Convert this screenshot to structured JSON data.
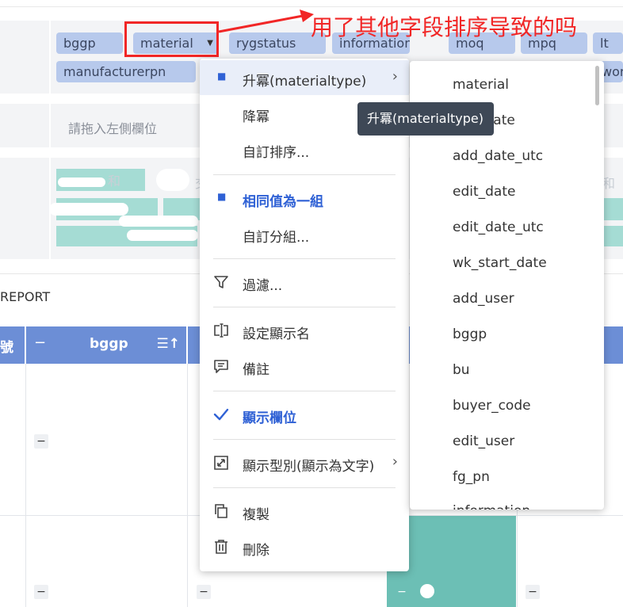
{
  "pivot": {
    "row_fields": [
      "bggp",
      "material",
      "rygstatus",
      "information",
      "moq",
      "mpq",
      "lt",
      "manufacturerpn",
      "wor"
    ],
    "drop_hint": "請拖入左側欄位",
    "faint_texts": [
      "和",
      "和",
      "交"
    ]
  },
  "report": {
    "title": "REPORT"
  },
  "grid": {
    "header_col": "bggp",
    "header_prefix": "號",
    "collapse_symbol": "−"
  },
  "annotation": {
    "text": "用了其他字段排序导致的吗"
  },
  "context_menu": {
    "sort_asc": "升冪(materialtype)",
    "sort_desc": "降冪",
    "custom_sort": "自訂排序...",
    "group_same": "相同值為一組",
    "custom_group": "自訂分組...",
    "filter": "過濾...",
    "set_display_name": "設定顯示名",
    "note": "備註",
    "show_field": "顯示欄位",
    "display_type": "顯示型別(顯示為文字)",
    "copy": "複製",
    "delete": "刪除"
  },
  "submenu": {
    "items": [
      "material",
      "add_date",
      "add_date_utc",
      "edit_date",
      "edit_date_utc",
      "wk_start_date",
      "add_user",
      "bggp",
      "bu",
      "buyer_code",
      "edit_user",
      "fg_pn",
      "information"
    ]
  },
  "tooltip": {
    "text": "升冪(materialtype)"
  },
  "colors": {
    "chip": "#b7c9ec",
    "header": "#6c8ed6",
    "accent_blue": "#2f61d5",
    "annotation_red": "#f12626",
    "teal": "#6cbfb5"
  }
}
